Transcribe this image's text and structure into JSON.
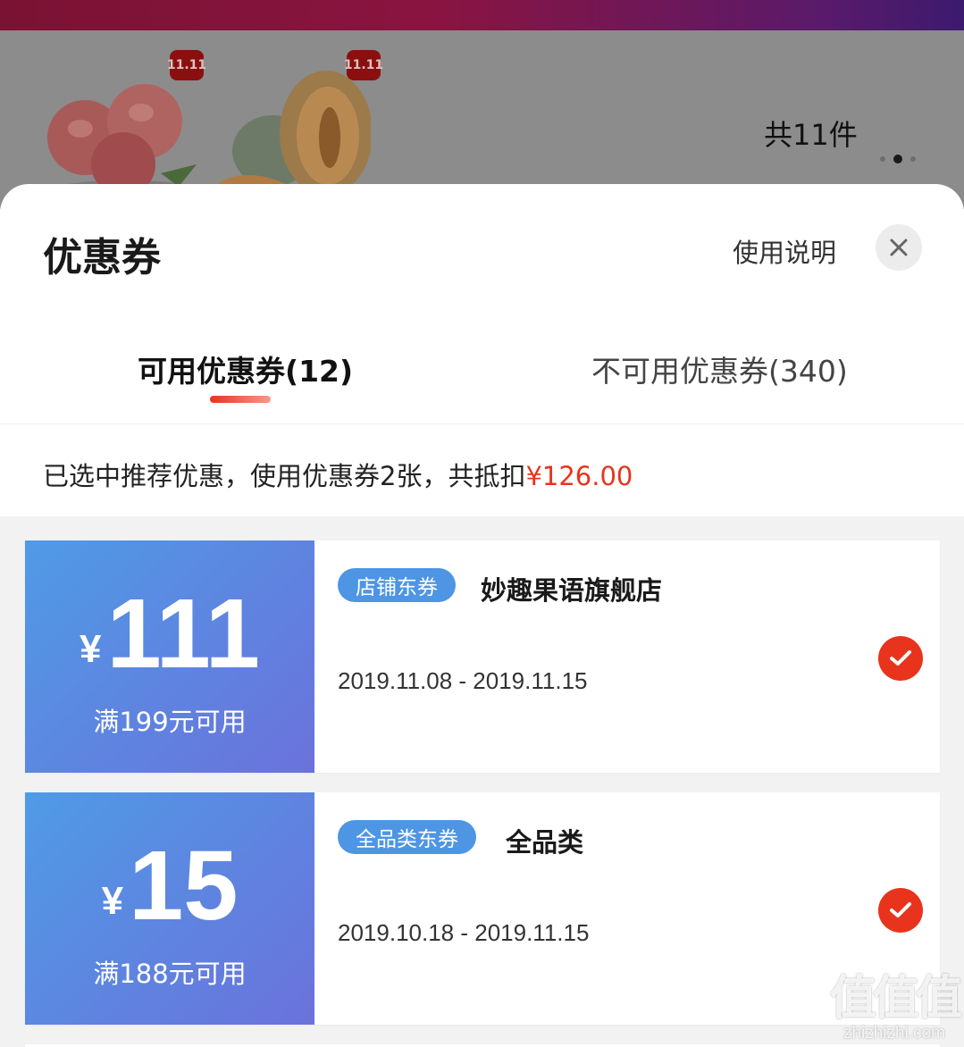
{
  "background": {
    "tags": [
      "11.11",
      "11.11"
    ],
    "product_count": "共11件",
    "products": [
      "peach-image",
      "melon-image"
    ]
  },
  "sheet": {
    "title": "优惠券",
    "usage_label": "使用说明",
    "close_icon": "close-icon"
  },
  "tabs": [
    {
      "label": "可用优惠券(12)",
      "active": true
    },
    {
      "label": "不可用优惠券(340)",
      "active": false
    }
  ],
  "summary": {
    "text": "已选中推荐优惠，使用优惠券2张，共抵扣",
    "amount": "¥126.00"
  },
  "coupons": [
    {
      "currency": "¥",
      "value": "111",
      "condition": "满199元可用",
      "badge": "店铺东券",
      "shop": "妙趣果语旗舰店",
      "dates": "2019.11.08 - 2019.11.15",
      "selected": true
    },
    {
      "currency": "¥",
      "value": "15",
      "condition": "满188元可用",
      "badge": "全品类东券",
      "shop": "全品类",
      "dates": "2019.10.18 - 2019.11.15",
      "selected": true
    }
  ],
  "watermark": {
    "logo": "值值值",
    "site": "zhizhizhi.com"
  },
  "colors": {
    "accent_red": "#e8341c",
    "coupon_blue": "#5d86e0",
    "badge_blue": "#4e95e4"
  }
}
